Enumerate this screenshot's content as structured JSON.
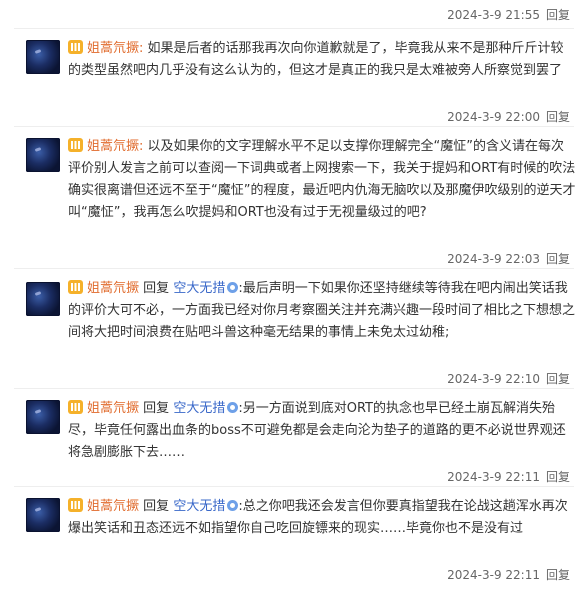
{
  "reply_label": "回复",
  "top_timestamp": "2024-3-9 21:55",
  "comments": [
    {
      "user": "姐蒿氘撅:",
      "text": "如果是后者的话那我再次向你道歉就是了，毕竟我从来不是那种斤斤计较的类型虽然吧内几乎没有这么认为的，但这才是真正的我只是太难被旁人所察觉到罢了",
      "timestamp": "2024-3-9 22:00"
    },
    {
      "user": "姐蒿氘撅:",
      "text": "以及如果你的文字理解水平不足以支撑你理解完全“魔怔”的含义请在每次评价别人发言之前可以查阅一下词典或者上网搜索一下，我关于提妈和ORT有时候的吹法确实很离谱但还远不至于“魔怔”的程度，最近吧内仇海无脑吹以及那魔伊吹级别的逆天才叫“魔怔”，我再怎么吹提妈和ORT也没有过于无视量级过的吧?",
      "timestamp": "2024-3-9 22:03"
    },
    {
      "user": "姐蒿氘撅",
      "reply_word": "回复",
      "reply_target": "空大无措",
      "text": ":最后声明一下如果你还坚持继续等待我在吧内闹出笑话我的评价大可不必，一方面我已经对你月考察圈关注并充满兴趣一段时间了相比之下想想之间将大把时间浪费在贴吧斗兽这种毫无结果的事情上未免太过幼稚;",
      "timestamp": "2024-3-9 22:10"
    },
    {
      "user": "姐蒿氘撅",
      "reply_word": "回复",
      "reply_target": "空大无措",
      "text": ":另一方面说到底对ORT的执念也早已经土崩瓦解消失殆尽，毕竟任何露出血条的boss不可避免都是会走向沦为垫子的道路的更不必说世界观还将急剧膨胀下去……",
      "timestamp": "2024-3-9 22:11"
    },
    {
      "user": "姐蒿氘撅",
      "reply_word": "回复",
      "reply_target": "空大无措",
      "text": ":总之你吧我还会发言但你要真指望我在论战这趟浑水再次爆出笑话和丑态还远不如指望你自己吃回旋镖来的现实……毕竟你也不是没有过",
      "timestamp": "2024-3-9 22:11"
    }
  ]
}
